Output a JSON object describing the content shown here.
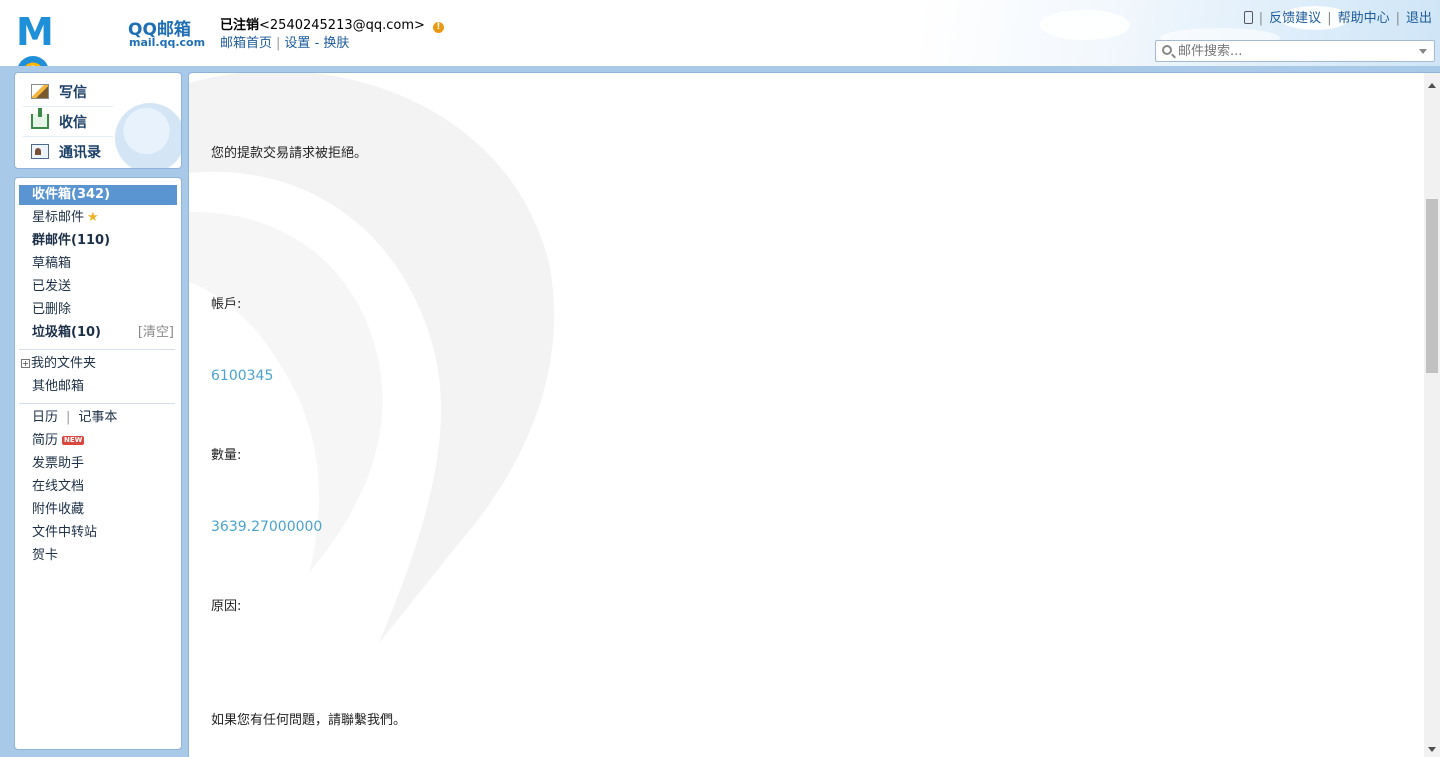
{
  "header": {
    "logo_text": "MOil",
    "brand": "QQ邮箱",
    "domain": "mail.qq.com",
    "account_name": "已注销",
    "account_email": "<2540245213@qq.com>",
    "warn_symbol": "!",
    "subnav": {
      "home": "邮箱首页",
      "settings": "设置",
      "dash": "-",
      "skin": "换肤"
    },
    "top_links": {
      "feedback": "反馈建议",
      "help": "帮助中心",
      "logout": "退出"
    },
    "search": {
      "placeholder": "邮件搜索..."
    }
  },
  "compose": {
    "write": "写信",
    "receive": "收信",
    "contacts": "通讯录"
  },
  "folders": {
    "inbox": "收件箱(342)",
    "starred": "星标邮件",
    "group": "群邮件(110)",
    "drafts": "草稿箱",
    "sent": "已发送",
    "deleted": "已删除",
    "spam": "垃圾箱(10)",
    "spam_clear": "[清空]",
    "my_folders": "我的文件夹",
    "other_mailbox": "其他邮箱",
    "calendar": "日历",
    "notebook": "记事本",
    "resume": "简历",
    "resume_badge": "NEW",
    "invoice": "发票助手",
    "docs": "在线文档",
    "attachments": "附件收藏",
    "transfer": "文件中转站",
    "cards": "贺卡"
  },
  "email": {
    "line1": "您的提款交易請求被拒絕。",
    "account_label": "帳戶:",
    "account_value": "6100345",
    "amount_label": "數量:",
    "amount_value": "3639.27000000",
    "reason_label": "原因:",
    "closing": "如果您有任何問題，請聯繫我們。"
  },
  "colors": {
    "accent": "#5a95d1",
    "frame": "#a9c9e9",
    "link": "#4aa3cf"
  }
}
